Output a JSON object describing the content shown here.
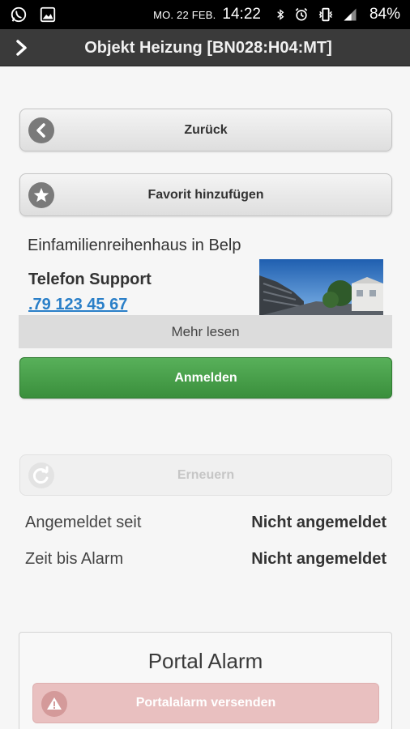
{
  "status_bar": {
    "date": "MO. 22 FEB.",
    "time": "14:22",
    "battery": "84%"
  },
  "header": {
    "title": "Objekt Heizung [BN028:H04:MT]"
  },
  "buttons": {
    "back_label": "Zurück",
    "favorite_label": "Favorit hinzufügen",
    "login_label": "Anmelden",
    "renew_label": "Erneuern",
    "alarm_label": "Portalalarm versenden"
  },
  "object": {
    "subtitle": "Einfamilienreihenhaus in Belp",
    "phone_label": "Telefon Support",
    "phone_number": ".79 123 45 67",
    "more_label": "Mehr lesen"
  },
  "status_rows": [
    {
      "label": "Angemeldet seit",
      "value": "Nicht angemeldet"
    },
    {
      "label": "Zeit bis Alarm",
      "value": "Nicht angemeldet"
    }
  ],
  "portal_alarm": {
    "title": "Portal Alarm"
  },
  "colors": {
    "login_green": "#4aa04c",
    "link_blue": "#2a7fc8",
    "alarm_disabled": "#e9c0c0",
    "header_bg": "#3a3a3a"
  },
  "icons": {
    "status_left": [
      "whatsapp-icon",
      "image-icon"
    ],
    "status_right": [
      "bluetooth-icon",
      "alarm-clock-icon",
      "vibrate-icon",
      "signal-icon"
    ],
    "header": "chevron-right-icon",
    "back": "arrow-left-circle-icon",
    "favorite": "star-circle-icon",
    "renew": "refresh-circle-icon",
    "alarm": "warning-circle-icon"
  }
}
